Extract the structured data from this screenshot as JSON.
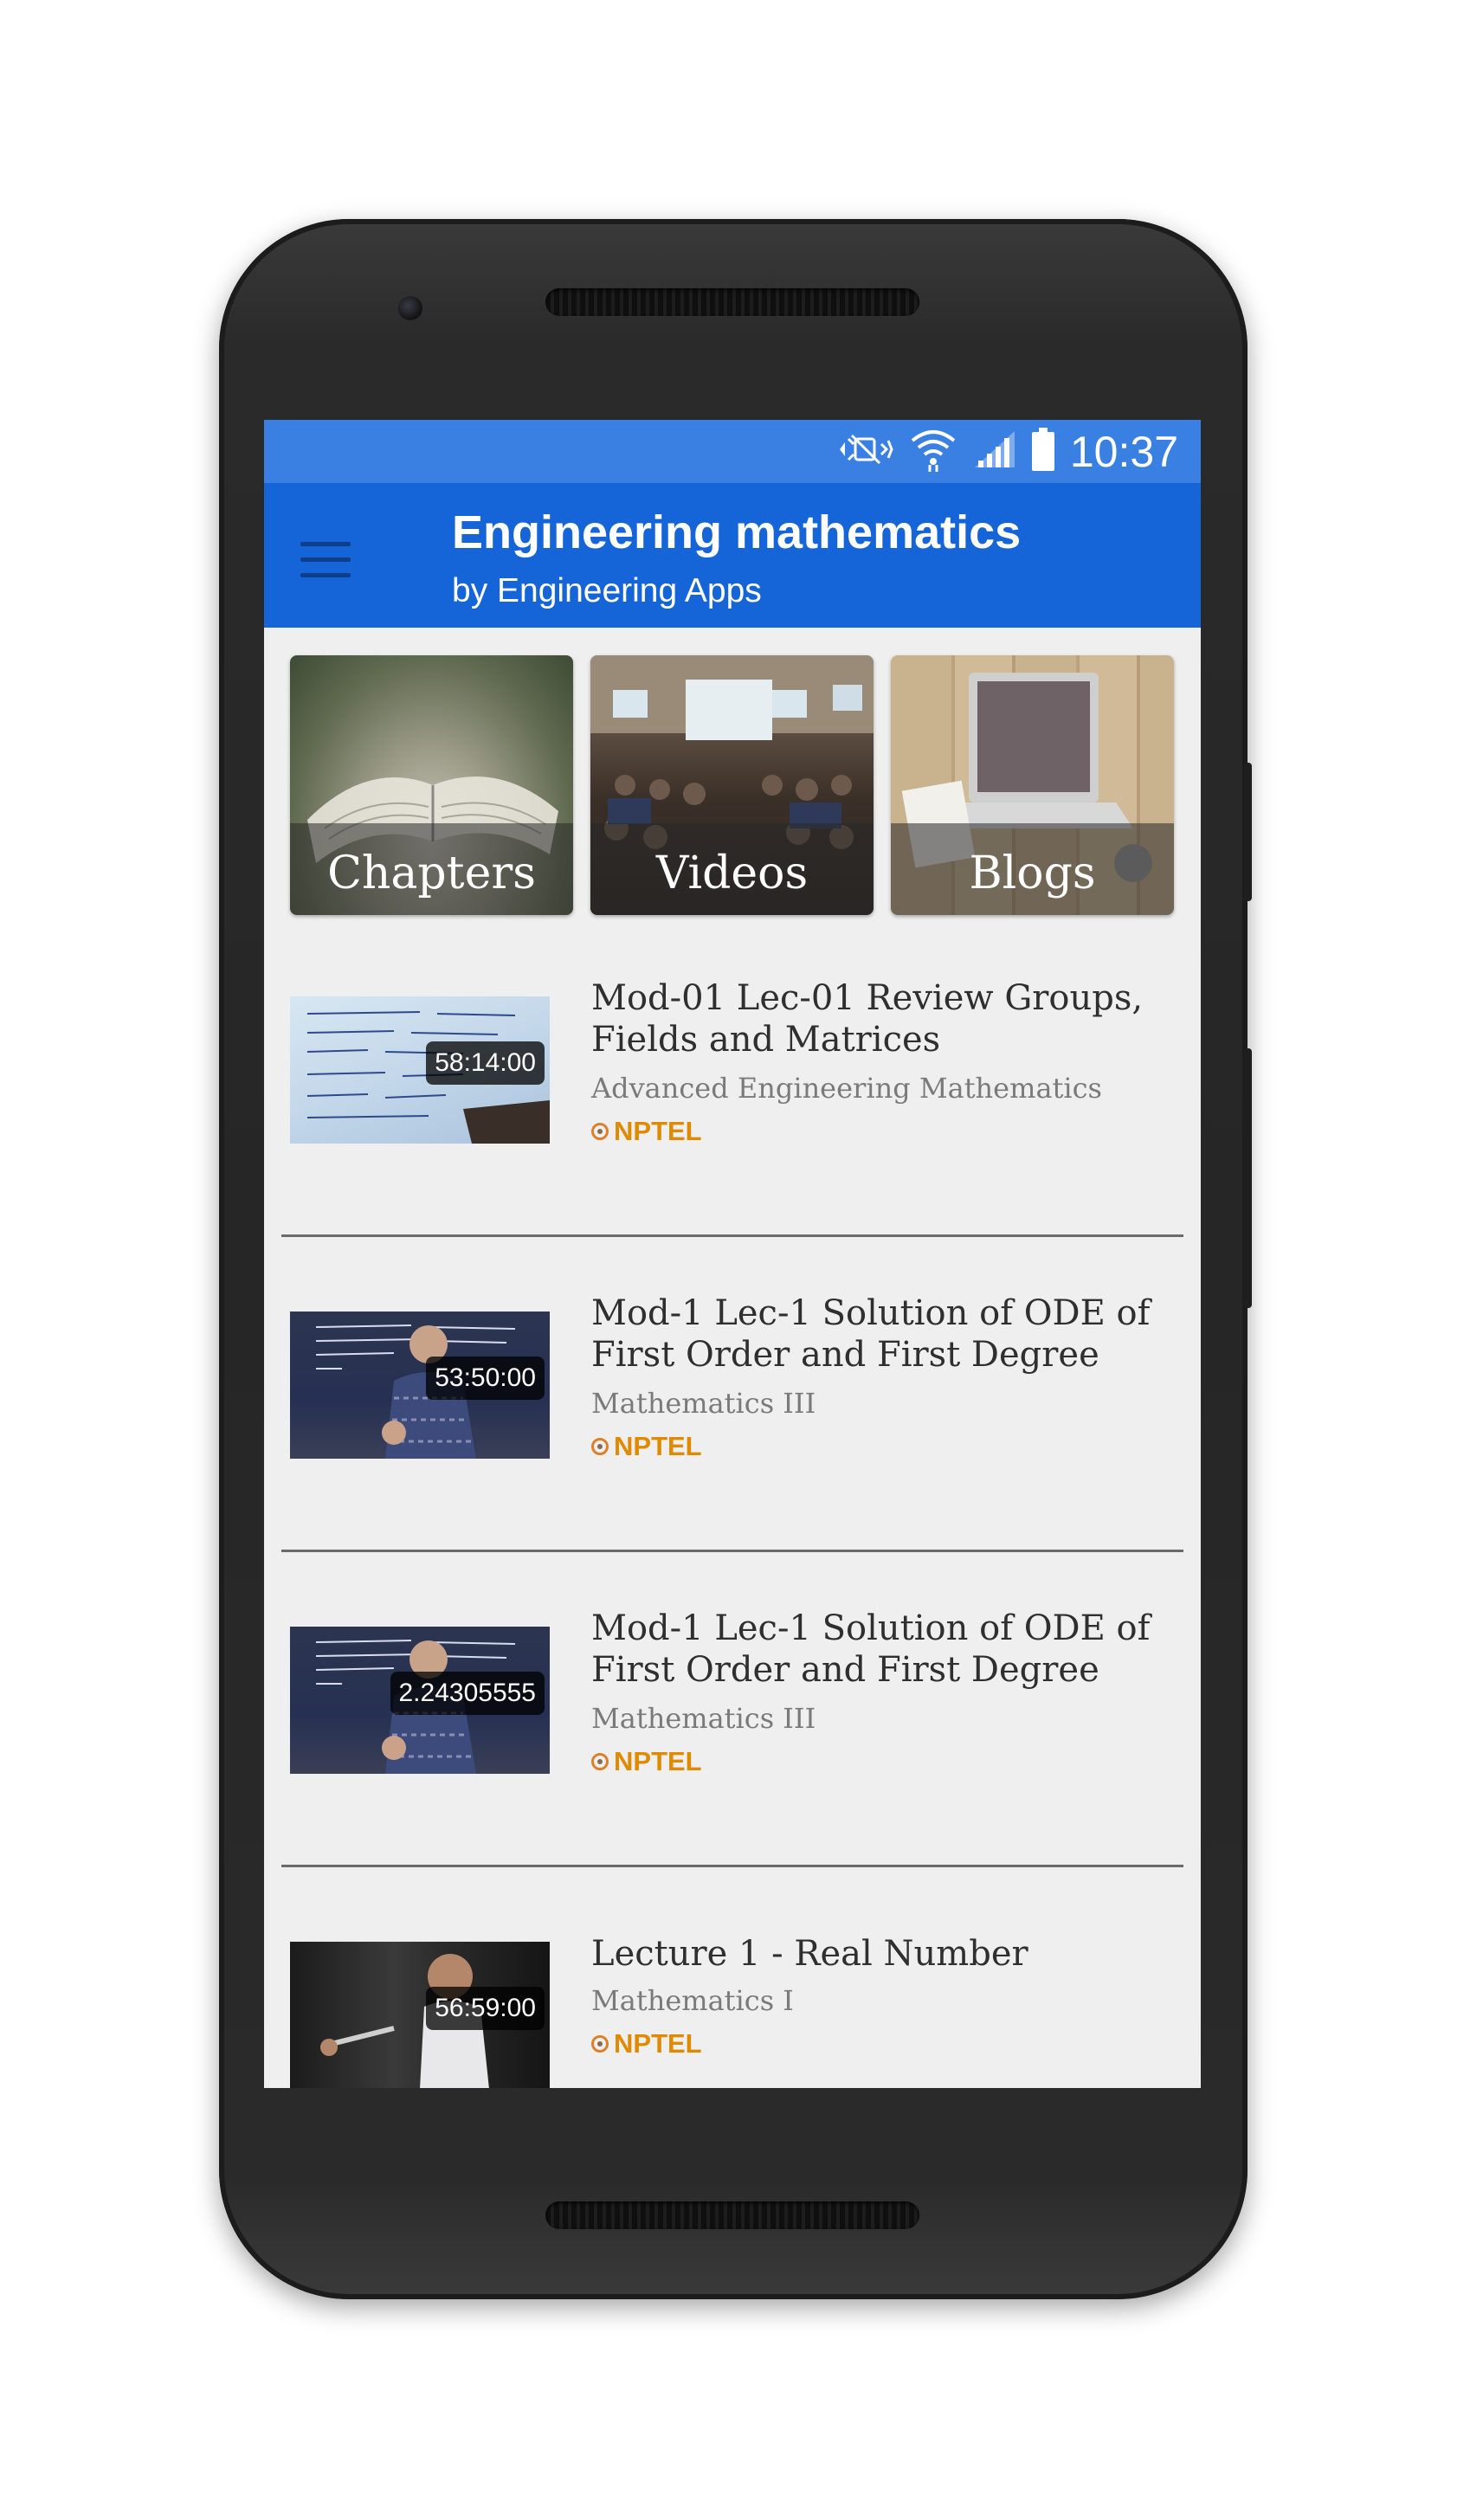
{
  "status_bar": {
    "time": "10:37",
    "icons": [
      "mute-icon",
      "wifi-icon",
      "signal-icon",
      "battery-icon"
    ]
  },
  "app_bar": {
    "title": "Engineering mathematics",
    "subtitle": "by Engineering Apps",
    "menu_icon": "hamburger-menu-icon"
  },
  "tiles": [
    {
      "label": "Chapters"
    },
    {
      "label": "Videos"
    },
    {
      "label": "Blogs"
    }
  ],
  "videos": [
    {
      "title": "Mod-01 Lec-01 Review Groups, Fields and Matrices",
      "course": "Advanced Engineering Mathematics",
      "duration": "58:14:00",
      "source": "NPTEL"
    },
    {
      "title": "Mod-1 Lec-1 Solution of ODE of First Order and First Degree",
      "course": "Mathematics III",
      "duration": "53:50:00",
      "source": "NPTEL"
    },
    {
      "title": "Mod-1 Lec-1 Solution of ODE of First Order and First Degree",
      "course": "Mathematics III",
      "duration": "2.24305555",
      "source": "NPTEL"
    },
    {
      "title": "Lecture 1 - Real Number",
      "course": "Mathematics I",
      "duration": "56:59:00",
      "source": "NPTEL"
    }
  ],
  "colors": {
    "status_bar": "#3a80e3",
    "app_bar": "#1565d8",
    "background": "#efefef",
    "source_accent": "#e08a00"
  }
}
